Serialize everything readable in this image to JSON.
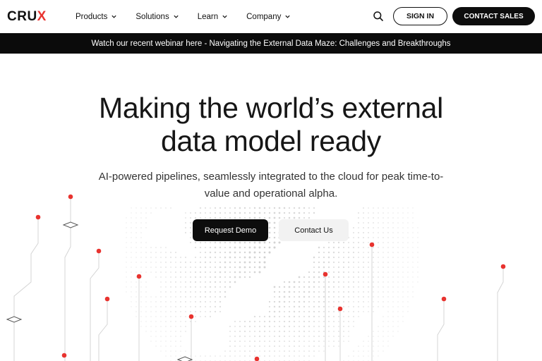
{
  "header": {
    "logo": {
      "text_a": "CRU",
      "text_b": "X"
    },
    "nav": [
      {
        "label": "Products"
      },
      {
        "label": "Solutions"
      },
      {
        "label": "Learn"
      },
      {
        "label": "Company"
      }
    ],
    "search_icon": "search-icon",
    "sign_in_label": "SIGN IN",
    "contact_sales_label": "CONTACT SALES"
  },
  "banner": {
    "text": "Watch our recent webinar here - Navigating the External Data Maze: Challenges and Breakthroughs"
  },
  "hero": {
    "title_line1": "Making the world’s external",
    "title_line2": "data model ready",
    "subtitle": "AI-powered pipelines, seamlessly integrated to the cloud for peak time-to-value and operational alpha.",
    "primary_button": "Request Demo",
    "secondary_button": "Contact Us"
  },
  "colors": {
    "accent_red": "#e8332f",
    "dark": "#0d0d0d",
    "banner_bg": "#0b0b0b",
    "dot_grey": "#c7c7c7"
  }
}
